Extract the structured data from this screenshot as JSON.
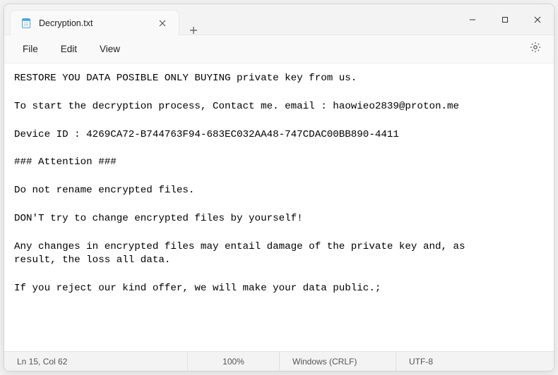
{
  "titlebar": {
    "tab_title": "Decryption.txt",
    "tab_icon_name": "notepad-icon",
    "close_tab_glyph": "✕",
    "new_tab_glyph": "+"
  },
  "window_controls": {
    "minimize": "—",
    "maximize": "▢",
    "close": "✕"
  },
  "menubar": {
    "file": "File",
    "edit": "Edit",
    "view": "View"
  },
  "content_text": "RESTORE YOU DATA POSIBLE ONLY BUYING private key from us.\n\nTo start the decryption process, Contact me. email : haowieo2839@proton.me\n\nDevice ID : 4269CA72-B744763F94-683EC032AA48-747CDAC00BB890-4411\n\n### Attention ###\n\nDo not rename encrypted files.\n\nDON'T try to change encrypted files by yourself!\n\nAny changes in encrypted files may entail damage of the private key and, as\nresult, the loss all data.\n\nIf you reject our kind offer, we will make your data public.;",
  "statusbar": {
    "position": "Ln 15, Col 62",
    "zoom": "100%",
    "line_ending": "Windows (CRLF)",
    "encoding": "UTF-8"
  }
}
